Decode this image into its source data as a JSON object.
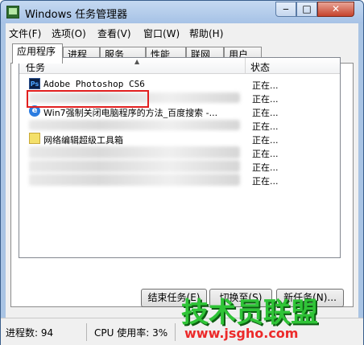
{
  "window": {
    "title": "Windows 任务管理器",
    "buttons": {
      "minimize": "‒",
      "maximize": "□",
      "close": "✕"
    }
  },
  "menu": [
    "文件(F)",
    "选项(O)",
    "查看(V)",
    "窗口(W)",
    "帮助(H)"
  ],
  "tabs": [
    "应用程序",
    "进程",
    "服务",
    "性能",
    "联网",
    "用户"
  ],
  "task_list": {
    "columns": {
      "task": "任务",
      "status": "状态"
    },
    "rows": [
      {
        "name": "Adobe Photoshop CS6",
        "status": "正在...",
        "icon": "photoshop-icon"
      },
      {
        "name": "",
        "status": "正在...",
        "icon": ""
      },
      {
        "name": "Win7强制关闭电脑程序的方法_百度搜索 -...",
        "status": "正在...",
        "icon": "ie-icon"
      },
      {
        "name": "",
        "status": "正在...",
        "icon": ""
      },
      {
        "name": "网络编辑超级工具箱",
        "status": "正在...",
        "icon": "folder-icon"
      },
      {
        "name": "",
        "status": "正在...",
        "icon": ""
      },
      {
        "name": "",
        "status": "正在...",
        "icon": ""
      },
      {
        "name": "",
        "status": "正在...",
        "icon": ""
      }
    ]
  },
  "buttons": {
    "end_task": "结束任务(E)",
    "switch_to": "切换至(S)",
    "new_task": "新任务(N)..."
  },
  "statusbar": {
    "processes": "进程数: 94",
    "cpu": "CPU 使用率: 3%"
  },
  "watermark": {
    "brand": "技术员联盟",
    "url": "www.jsgho.com"
  },
  "colors": {
    "highlight": "#e21f1f",
    "watermark_green": "#2fc437",
    "watermark_red": "#ec2a2a"
  }
}
